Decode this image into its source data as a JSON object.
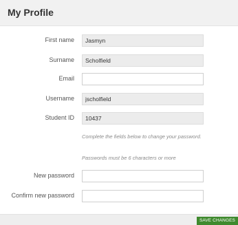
{
  "header": {
    "title": "My Profile"
  },
  "form": {
    "first_name": {
      "label": "First name",
      "value": "Jasmyn"
    },
    "surname": {
      "label": "Surname",
      "value": "Scholfield"
    },
    "email": {
      "label": "Email",
      "value": ""
    },
    "username": {
      "label": "Username",
      "value": "jscholfield"
    },
    "student_id": {
      "label": "Student ID",
      "value": "10437"
    },
    "help_change": "Complete the fields below to change your password.",
    "help_length": "Passwords must be 6 characters or more",
    "new_password": {
      "label": "New password",
      "value": ""
    },
    "confirm_password": {
      "label": "Confirm new password",
      "value": ""
    }
  },
  "footer": {
    "save_label": "SAVE CHANGES"
  },
  "colors": {
    "save_button": "#3f8a2e",
    "header_bg": "#f1f1f1",
    "readonly_bg": "#ececec"
  }
}
